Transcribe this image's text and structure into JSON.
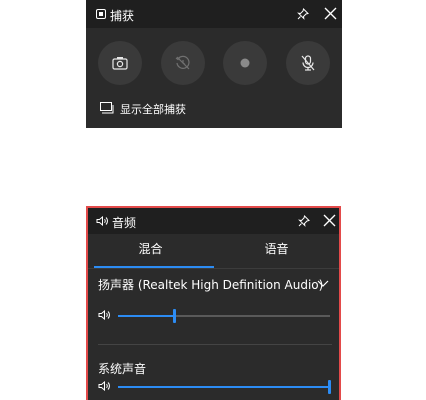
{
  "capture": {
    "title": "捕获",
    "show_all_label": "显示全部捕获",
    "buttons": [
      {
        "name": "screenshot",
        "icon": "camera-icon"
      },
      {
        "name": "record-last",
        "icon": "rewind-clock-icon"
      },
      {
        "name": "record",
        "icon": "record-dot-icon"
      },
      {
        "name": "mic",
        "icon": "mic-off-icon"
      }
    ]
  },
  "audio": {
    "title": "音频",
    "tabs": [
      {
        "label": "混合",
        "selected": true
      },
      {
        "label": "语音",
        "selected": false
      }
    ],
    "device": {
      "label": "扬声器 (Realtek High Definition Audio)",
      "volume_percent": 27
    },
    "system_sound": {
      "label": "系统声音",
      "volume_percent": 100
    }
  },
  "colors": {
    "panel_bg": "#2b2b2b",
    "titlebar_bg": "#1f1f1f",
    "accent": "#2c8cf4",
    "highlight_border": "#e34a4a"
  }
}
